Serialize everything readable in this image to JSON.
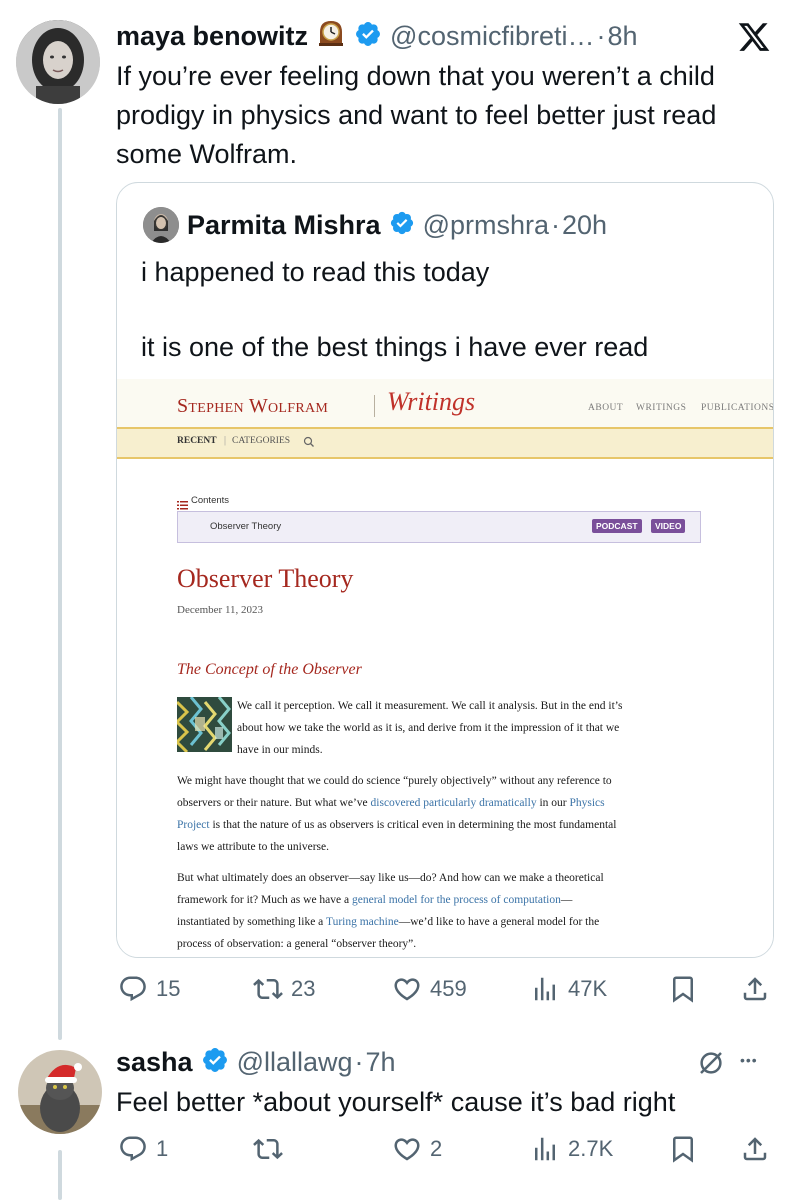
{
  "tweet": {
    "author_name": "maya benowitz",
    "author_emoji": "🕰️",
    "handle": "@cosmicfibreti…",
    "sep": "·",
    "time": "8h",
    "text": "If you’re ever feeling down that you weren’t a child prodigy in physics and want to feel better just read some Wolfram.",
    "logo": "x-logo-icon",
    "stats": {
      "replies": "15",
      "retweets": "23",
      "likes": "459",
      "views": "47K"
    }
  },
  "quote": {
    "author_name": "Parmita Mishra",
    "handle": "@prmshra",
    "sep": "·",
    "time": "20h",
    "line1": "i happened to read this today",
    "line2": "it is one of the best things i have ever read",
    "article": {
      "site_name": "Stephen Wolfram",
      "site_section": "Writings",
      "nav": [
        "About",
        "Writings",
        "Publications"
      ],
      "subnav_recent": "RECENT",
      "subnav_divider": "|",
      "subnav_categories": "CATEGORIES",
      "contents_label": "Contents",
      "contents_item": "Observer Theory",
      "badge_podcast": "PODCAST",
      "badge_video": "VIDEO",
      "title": "Observer Theory",
      "date": "December 11, 2023",
      "section_heading": "The Concept of the Observer",
      "p1_l1": "We call it perception. We call it measurement. We call it analysis. But in the end it’s",
      "p1_l2": "about how we take the world as it is, and derive from it the impression of it that we",
      "p1_l3": "have in our minds.",
      "p2_l1": "We might have thought that we could do science “purely objectively” without any reference to",
      "p2_l2_a": "observers or their nature. But what we’ve ",
      "p2_l2_link": "discovered particularly dramatically",
      "p2_l2_b": " in our ",
      "p2_l2_link2": "Physics",
      "p2_l3_link": "Project",
      "p2_l3_b": " is that the nature of us as observers is critical even in determining the most fundamental",
      "p2_l4": "laws we attribute to the universe.",
      "p3_l1": "But what ultimately does an observer—say like us—do? And how can we make a theoretical",
      "p3_l2_a": "framework for it? Much as we have a ",
      "p3_l2_link": "general model for the process of computation",
      "p3_l2_b": "—",
      "p3_l3_a": "instantiated by something like a ",
      "p3_l3_link": "Turing machine",
      "p3_l3_b": "—we’d like to have a general model for the",
      "p3_l4": "process of observation: a general “observer theory”."
    }
  },
  "reply": {
    "author_name": "sasha",
    "handle": "@llallawg",
    "sep": "·",
    "time": "7h",
    "text": "Feel better *about yourself* cause it’s bad right",
    "more": "•••",
    "stats": {
      "replies": "1",
      "retweets": "",
      "likes": "2",
      "views": "2.7K"
    }
  },
  "colors": {
    "verified": "#1d9bf0",
    "muted": "#536471",
    "border": "#cfd9de",
    "wolfram_red": "#a5281f"
  }
}
